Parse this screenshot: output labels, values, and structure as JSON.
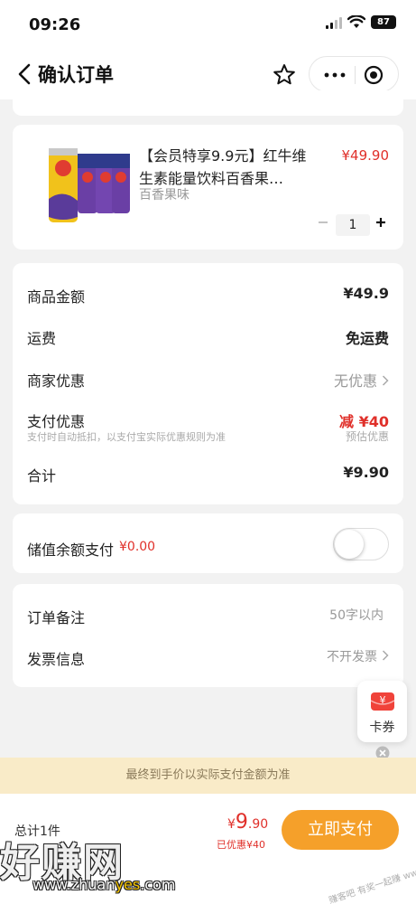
{
  "status_bar": {
    "time": "09:26",
    "battery": "87"
  },
  "nav": {
    "title": "确认订单"
  },
  "product": {
    "name": "【会员特享9.9元】红牛维生素能量饮料百香果…",
    "price": "¥49.90",
    "spec": "百香果味",
    "quantity": "1"
  },
  "amounts": {
    "goods_label": "商品金额",
    "goods_value": "¥49.9",
    "shipping_label": "运费",
    "shipping_value": "免运费",
    "merchant_label": "商家优惠",
    "merchant_value": "无优惠",
    "payment_label": "支付优惠",
    "payment_value": "减 ¥40",
    "payment_note": "支付时自动抵扣，以支付宝实际优惠规则为准",
    "payment_estimate": "预估优惠",
    "total_label": "合计",
    "total_value": "¥9.90"
  },
  "balance": {
    "label": "储值余额支付",
    "amount": "¥0.00",
    "enabled": false
  },
  "remark": {
    "note_label": "订单备注",
    "note_placeholder": "50字以内",
    "invoice_label": "发票信息",
    "invoice_value": "不开发票"
  },
  "coupon": {
    "icon_text": "¥",
    "label": "卡券"
  },
  "notice": "最终到手价以实际支付金额为准",
  "footer": {
    "count_label": "总计1件",
    "price_yen": "¥",
    "price_int": "9",
    "price_dec": ".90",
    "saved": "已优惠¥40",
    "pay_button": "立即支付"
  },
  "watermark": {
    "text": "好赚网",
    "url_pre": "www.zhuan",
    "url_hl": "yes",
    "url_post": ".com",
    "corner": "赚客吧 有奖一起赚 www.zuanke8.com"
  },
  "colors": {
    "accent": "#f5a02a",
    "price_red": "#e0302a",
    "notice_bg": "#f9ebc8"
  },
  "icons": [
    "back-icon",
    "star-icon",
    "more-icon",
    "target-icon",
    "chevron-right-icon",
    "minus-icon",
    "plus-icon",
    "coupon-icon",
    "close-icon"
  ]
}
